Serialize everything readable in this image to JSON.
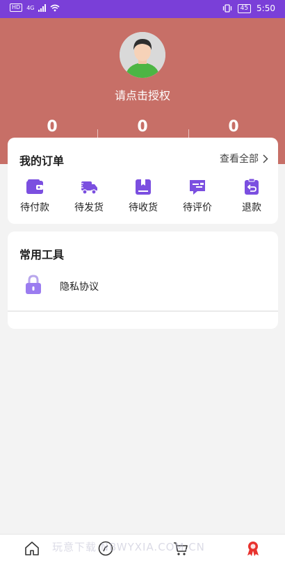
{
  "status_bar": {
    "network_tag": "HD",
    "signal_tag": "4G",
    "battery": "45",
    "time": "5:50"
  },
  "profile": {
    "auth_prompt": "请点击授权",
    "stats": [
      "0",
      "0",
      "0"
    ]
  },
  "orders": {
    "title": "我的订单",
    "view_all": "查看全部",
    "items": [
      {
        "label": "待付款",
        "icon": "wallet-icon"
      },
      {
        "label": "待发货",
        "icon": "truck-icon"
      },
      {
        "label": "待收货",
        "icon": "package-icon"
      },
      {
        "label": "待评价",
        "icon": "review-icon"
      },
      {
        "label": "退款",
        "icon": "refund-icon"
      }
    ]
  },
  "tools": {
    "title": "常用工具",
    "items": [
      {
        "label": "隐私协议",
        "icon": "lock-icon"
      }
    ]
  },
  "tab_bar": {
    "tabs": [
      "home-icon",
      "compass-icon",
      "cart-icon",
      "badge-icon"
    ]
  },
  "watermark": "玩意下载 NBWYXIA.COM.CN",
  "colors": {
    "status_bar": "#7a3fd8",
    "header": "#c76f67",
    "icon_purple": "#7b4fe0",
    "badge_red": "#e8322e"
  }
}
